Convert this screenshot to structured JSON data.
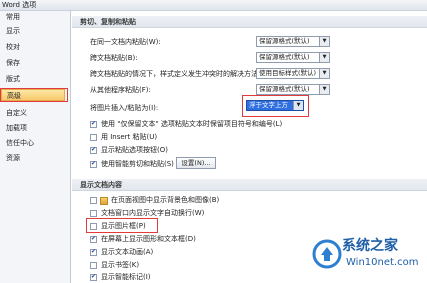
{
  "window": {
    "title": "Word 选项"
  },
  "sidebar": {
    "items": [
      "常用",
      "显示",
      "校对",
      "保存",
      "版式",
      "高级",
      "自定义",
      "加载项",
      "信任中心",
      "资源"
    ],
    "selected_index": 5
  },
  "sections": {
    "paste": {
      "title": "剪切、复制和粘贴",
      "rows": [
        {
          "label": "在同一文档内粘贴(W):",
          "value": "保留源格式(默认)"
        },
        {
          "label": "跨文档粘贴(B):",
          "value": "保留源格式(默认)"
        },
        {
          "label": "跨文档粘贴的情况下，样式定义发生冲突时的解决方法(E):",
          "value": "使用目标样式(默认)"
        },
        {
          "label": "从其他程序粘贴(F):",
          "value": "保留源格式(默认)"
        },
        {
          "label": "将图片插入/粘贴为(I):",
          "value": "浮于文字上方"
        }
      ],
      "checkboxes": [
        {
          "label": "使用 \"仅保留文本\" 选项粘贴文本时保留项目符号和编号(L)",
          "checked": true
        },
        {
          "label": "用 Insert 粘贴(U)",
          "checked": false
        },
        {
          "label": "显示粘贴选项按钮(O)",
          "checked": true
        },
        {
          "label": "使用智能剪切和粘贴(S)",
          "checked": true
        }
      ],
      "settings_button": "设置(N)..."
    },
    "display": {
      "title": "显示文档内容",
      "checkboxes": [
        {
          "label": "在页面视图中显示背景色和图像(B)",
          "checked": false
        },
        {
          "label": "文档窗口内显示文字自动换行(W)",
          "checked": false
        },
        {
          "label": "显示图片框(P)",
          "checked": false
        },
        {
          "label": "在屏幕上显示图形和文本框(D)",
          "checked": true
        },
        {
          "label": "显示文本动画(A)",
          "checked": true
        },
        {
          "label": "显示书签(K)",
          "checked": false
        },
        {
          "label": "显示智能标记(I)",
          "checked": true
        }
      ]
    }
  },
  "watermark": {
    "line1": "系统之家",
    "line2": "Win10net.com"
  },
  "colors": {
    "accent": "#2f6fe0",
    "highlight_box": "#e23b3b",
    "selected_sidebar": "#f8c96a"
  }
}
